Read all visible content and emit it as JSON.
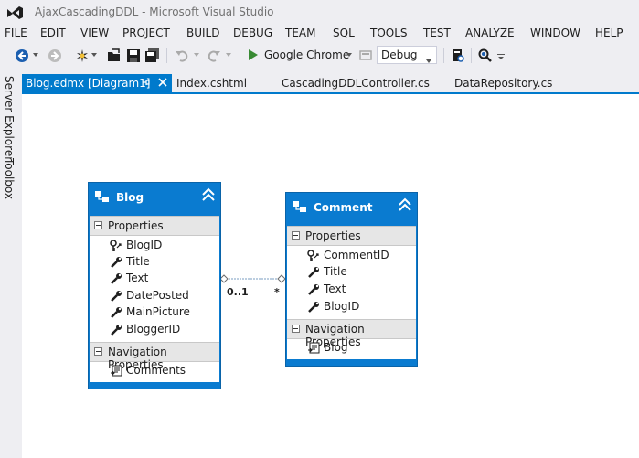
{
  "window": {
    "title": "AjaxCascadingDDL - Microsoft Visual Studio"
  },
  "menu": [
    "FILE",
    "EDIT",
    "VIEW",
    "PROJECT",
    "BUILD",
    "DEBUG",
    "TEAM",
    "SQL",
    "TOOLS",
    "TEST",
    "ANALYZE",
    "WINDOW",
    "HELP"
  ],
  "toolbar": {
    "run_target": "Google Chrome",
    "configuration": "Debug",
    "icons": [
      "back-icon",
      "forward-icon",
      "new-project-icon",
      "open-file-icon",
      "save-icon",
      "save-all-icon",
      "undo-icon",
      "redo-icon",
      "start-icon",
      "solution-config-icon",
      "find-in-files-icon",
      "quick-find-icon"
    ]
  },
  "tabs": [
    "Blog.edmx [Diagram1]",
    "Index.cshtml",
    "CascadingDDLController.cs",
    "DataRepository.cs"
  ],
  "side_panels": [
    "Server Explorer",
    "Toolbox"
  ],
  "diagram": {
    "entities": [
      {
        "name": "Blog",
        "sections": [
          "Properties",
          "Navigation Properties"
        ],
        "properties": [
          "BlogID",
          "Title",
          "Text",
          "DatePosted",
          "MainPicture",
          "BloggerID"
        ],
        "navigation": [
          "Comments"
        ]
      },
      {
        "name": "Comment",
        "sections": [
          "Properties",
          "Navigation Properties"
        ],
        "properties": [
          "CommentID",
          "Title",
          "Text",
          "BlogID"
        ],
        "navigation": [
          "Blog"
        ]
      }
    ],
    "association": {
      "multiplicity_left": "0..1",
      "multiplicity_right": "*"
    }
  }
}
